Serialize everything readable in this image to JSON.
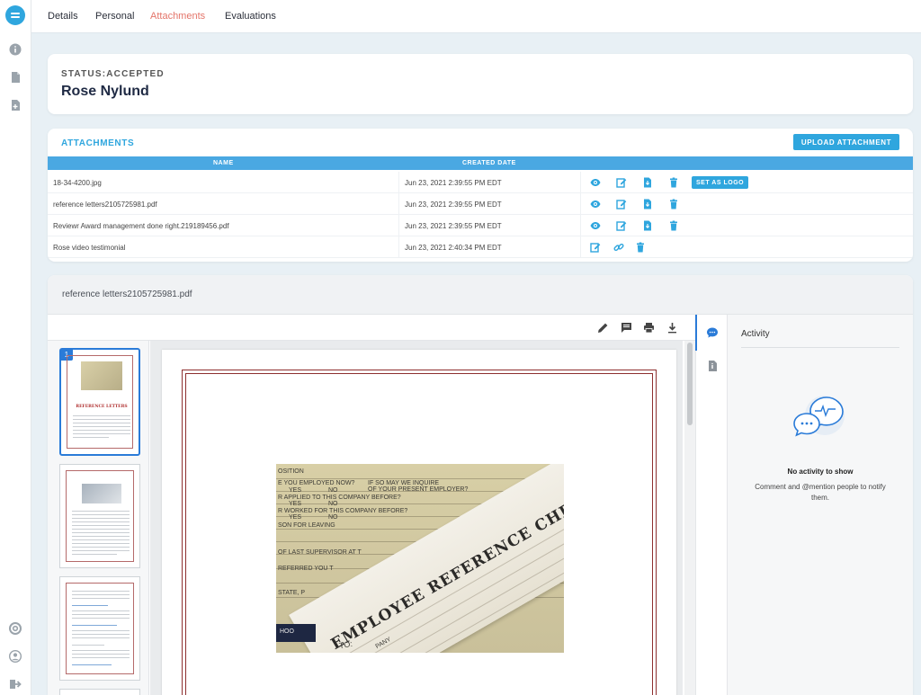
{
  "nav": {
    "tabs": [
      {
        "label": "Details"
      },
      {
        "label": "Personal"
      },
      {
        "label": "Attachments"
      },
      {
        "label": "Evaluations"
      }
    ],
    "active_tab": "Attachments"
  },
  "status": {
    "label": "STATUS:ACCEPTED",
    "name": "Rose Nylund"
  },
  "attachments": {
    "title": "ATTACHMENTS",
    "upload_label": "UPLOAD ATTACHMENT",
    "columns": {
      "name": "NAME",
      "created": "CREATED DATE"
    },
    "set_logo_label": "SET AS LOGO",
    "rows": [
      {
        "name": "18-34-4200.jpg",
        "created": "Jun 23, 2021 2:39:55 PM EDT"
      },
      {
        "name": "reference letters2105725981.pdf",
        "created": "Jun 23, 2021 2:39:55 PM EDT"
      },
      {
        "name": "Reviewr Award management done right.219189456.pdf",
        "created": "Jun 23, 2021 2:39:55 PM EDT"
      },
      {
        "name": "Rose video testimonial",
        "created": "Jun 23, 2021 2:40:34 PM EDT"
      }
    ]
  },
  "viewer": {
    "file_title": "reference letters2105725981.pdf",
    "thumb_page_number": "1",
    "thumb_heading": "REFERENCE LETTERS",
    "form_heading": "EMPLOYEE REFERENCE CHECK",
    "form_lines": [
      "OSITION",
      "E YOU EMPLOYED NOW?",
      "IF SO MAY WE INQUIRE",
      "OF YOUR PRESENT EMPLOYER?",
      "YES",
      "NO",
      "R APPLIED TO THIS COMPANY BEFORE?",
      "YES",
      "NO",
      "R WORKED FOR THIS COMPANY BEFORE?",
      "YES",
      "NO",
      "SON FOR LEAVING",
      "OF LAST SUPERVISOR AT T",
      "REFERRED YOU T",
      "STATE, P",
      "HOO",
      "TO:",
      "PANY"
    ]
  },
  "activity": {
    "title": "Activity",
    "empty_title": "No activity to show",
    "empty_sub": "Comment and @mention people to notify them."
  },
  "colors": {
    "accent": "#2fa6de",
    "active_tab": "#e4756a",
    "table_header": "#4aa8e2",
    "selected_blue": "#2a7bd8"
  }
}
